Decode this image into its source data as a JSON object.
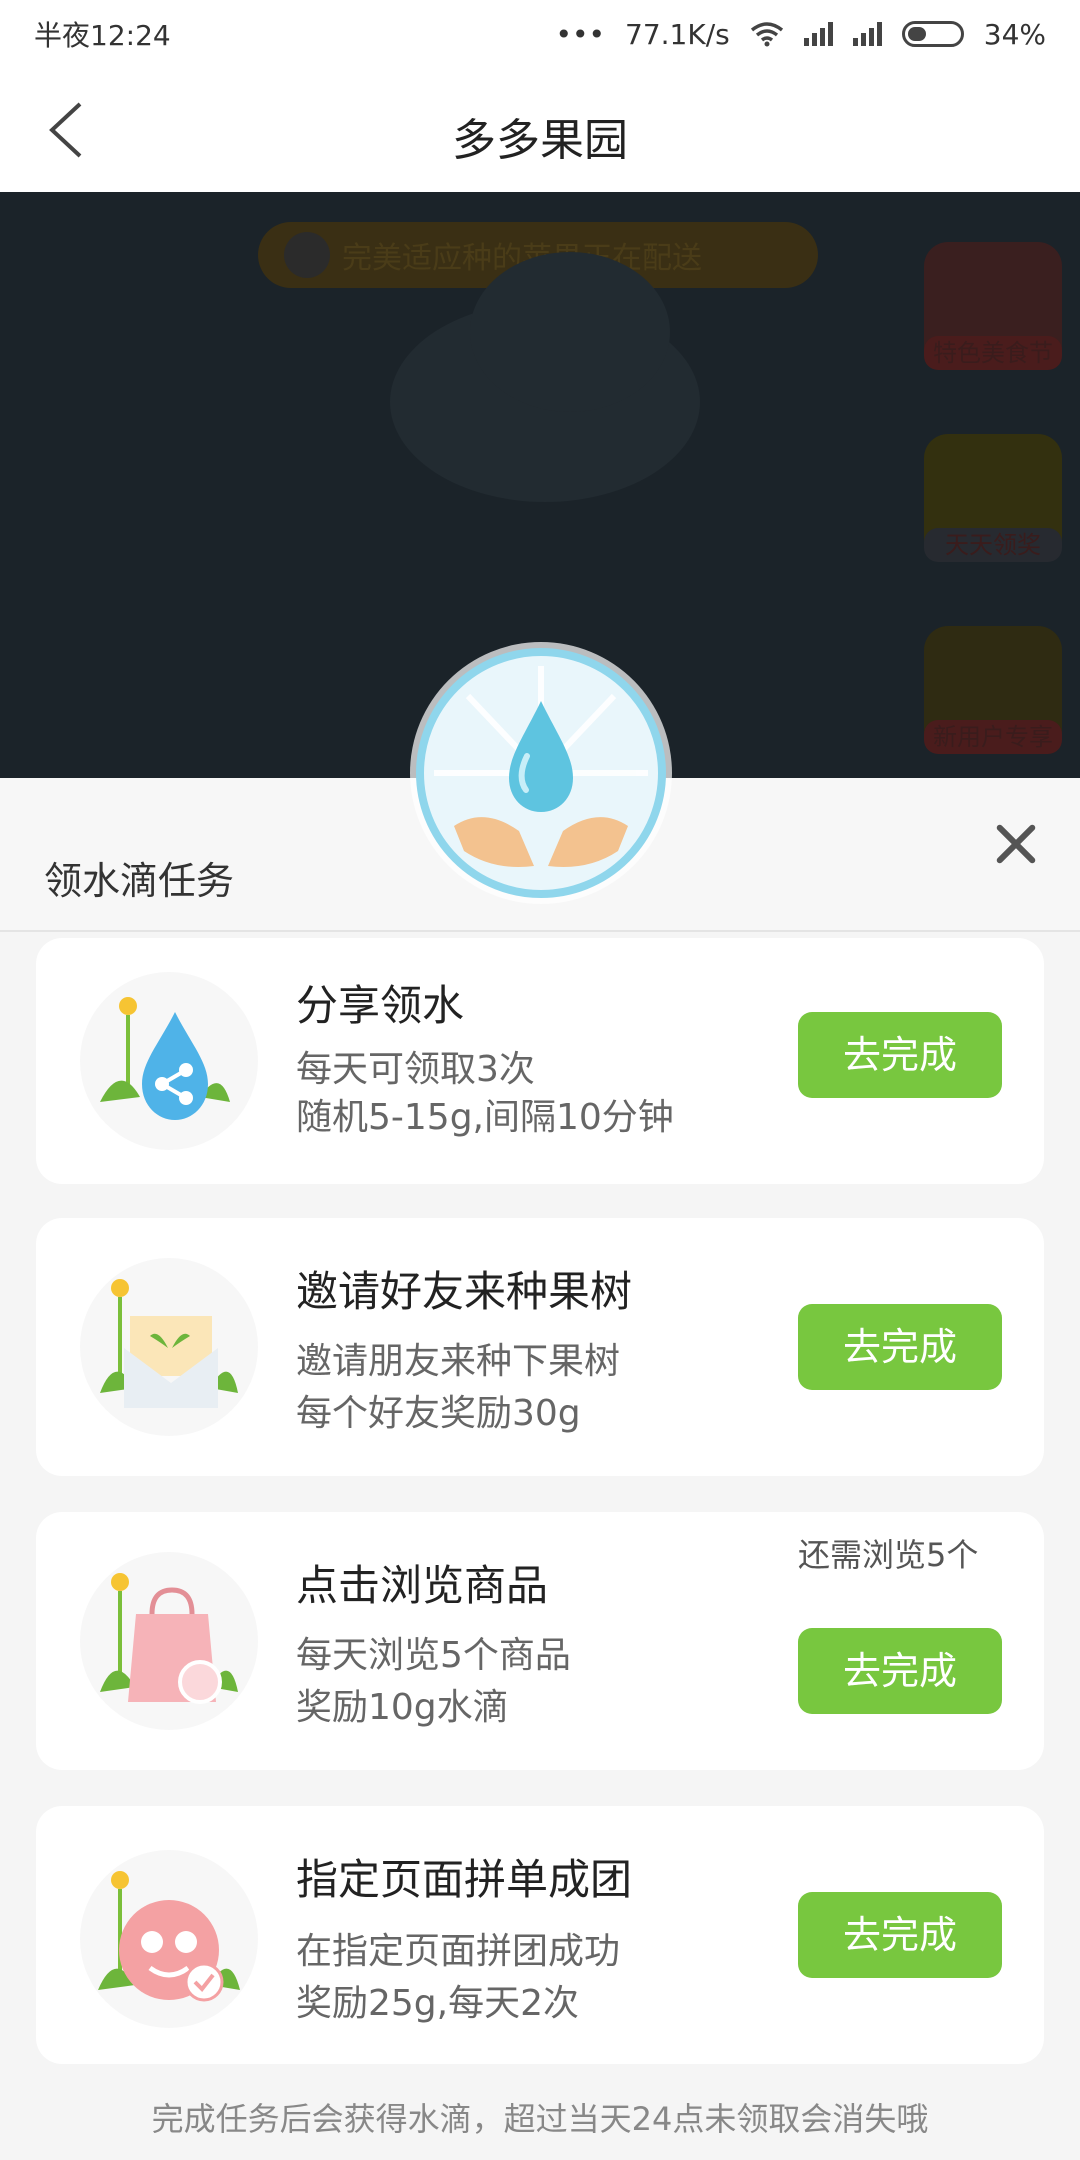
{
  "status_bar": {
    "time": "半夜12:24",
    "more": "•••",
    "speed": "77.1K/s",
    "battery_pct": "34%"
  },
  "header": {
    "title": "多多果园"
  },
  "background": {
    "banner_text": "完美适应种的苹果正在配送",
    "side_items": [
      "特色美食节",
      "天天领奖",
      "新用户专享"
    ]
  },
  "sheet": {
    "title": "领水滴任务",
    "footnote": "完成任务后会获得水滴，超过当天24点未领取会消失哦"
  },
  "tasks": [
    {
      "title": "分享领水",
      "line1": "每天可领取3次",
      "line2": "随机5-15g,间隔10分钟",
      "button": "去完成",
      "hint": ""
    },
    {
      "title": "邀请好友来种果树",
      "line1": "邀请朋友来种下果树",
      "line2": "每个好友奖励30g",
      "button": "去完成",
      "hint": ""
    },
    {
      "title": "点击浏览商品",
      "line1": "每天浏览5个商品",
      "line2": "奖励10g水滴",
      "button": "去完成",
      "hint": "还需浏览5个"
    },
    {
      "title": "指定页面拼单成团",
      "line1": "在指定页面拼团成功",
      "line2": "奖励25g,每天2次",
      "button": "去完成",
      "hint": ""
    }
  ],
  "colors": {
    "accent_green": "#78c73f",
    "overlay_dark": "#1b2329",
    "water_blue": "#4fb3e8"
  }
}
